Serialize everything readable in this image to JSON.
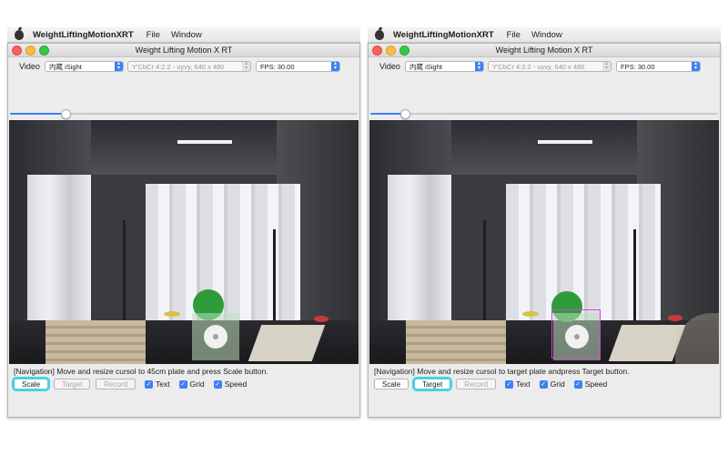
{
  "menubar": {
    "app_name": "WeightLiftingMotionXRT",
    "menu": [
      "File",
      "Window"
    ]
  },
  "window": {
    "title": "Weight Lifting Motion X RT"
  },
  "controls": {
    "video_label": "Video",
    "camera_value": "内蔵 iSight",
    "format_value": "Y'CbCr 4:2:2 - uyvy, 640 x 480",
    "fps_value": "FPS: 30.00"
  },
  "buttons": {
    "scale": "Scale",
    "target": "Target",
    "record": "Record"
  },
  "checkboxes": {
    "text": "Text",
    "grid": "Grid",
    "speed": "Speed"
  },
  "panels": [
    {
      "slider_fraction": 0.16,
      "navigation_text": "[Navigation] Move and resize cursol to 45cm plate and press Scale button.",
      "focused_button": "scale",
      "target_enabled": false
    },
    {
      "slider_fraction": 0.1,
      "navigation_text": "[Navigation] Move and resize cursol to target plate andpress Target button.",
      "focused_button": "target",
      "target_enabled": true
    }
  ],
  "colors": {
    "accent": "#3b82f6",
    "focus_ring": "#47d3df",
    "target_box": "#e03ee0",
    "plate_green": "#2f9c3b"
  }
}
